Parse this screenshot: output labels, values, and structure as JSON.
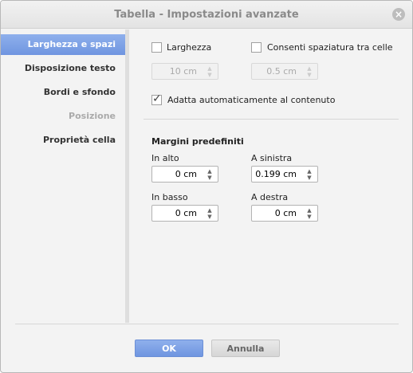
{
  "title": "Tabella - Impostazioni avanzate",
  "sidebar": {
    "items": [
      {
        "label": "Larghezza e spazi",
        "selected": true
      },
      {
        "label": "Disposizione testo"
      },
      {
        "label": "Bordi e sfondo"
      },
      {
        "label": "Posizione",
        "disabled": true
      },
      {
        "label": "Proprietà cella"
      }
    ]
  },
  "main": {
    "width_label": "Larghezza",
    "width_checked": false,
    "width_value": "10 cm",
    "spacing_label": "Consenti spaziatura tra celle",
    "spacing_checked": false,
    "spacing_value": "0.5 cm",
    "autofit_label": "Adatta automaticamente al contenuto",
    "autofit_checked": true,
    "margins_heading": "Margini predefiniti",
    "top_label": "In alto",
    "top_value": "0 cm",
    "left_label": "A sinistra",
    "left_value": "0.199 cm",
    "bottom_label": "In basso",
    "bottom_value": "0 cm",
    "right_label": "A destra",
    "right_value": "0 cm"
  },
  "buttons": {
    "ok": "OK",
    "cancel": "Annulla"
  },
  "colors": {
    "accent": "#7a9de4"
  }
}
